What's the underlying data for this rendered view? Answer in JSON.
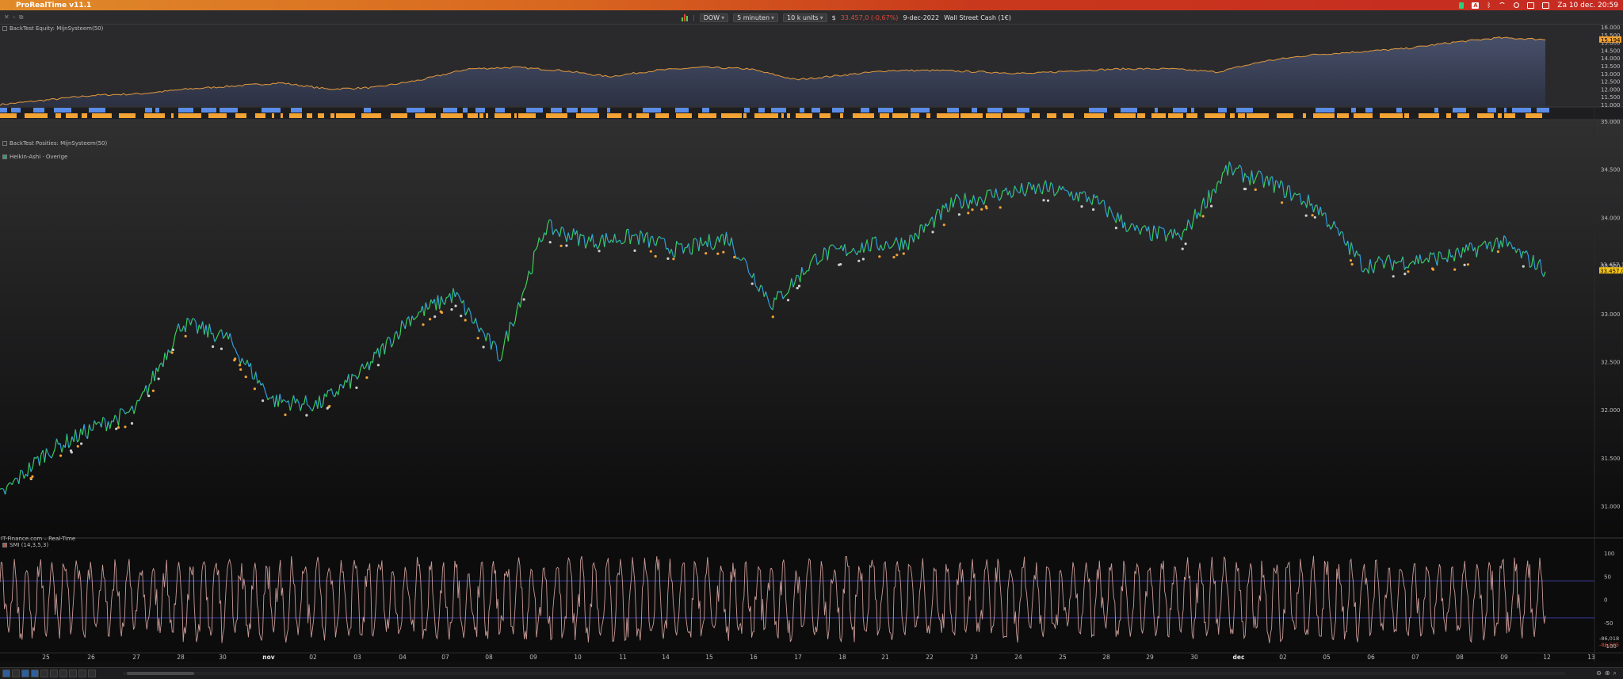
{
  "menubar": {
    "app_name": "ProRealTime v11.1",
    "clock": "Za 10 dec. 20:59",
    "icons": [
      "apple-icon",
      "green-status-icon",
      "a-input-icon",
      "bluetooth-icon",
      "wifi-icon",
      "search-icon",
      "display-icon",
      "control-center-icon"
    ]
  },
  "toolbar": {
    "instrument": "DOW",
    "timeframe": "5 minuten",
    "units": "10 k units",
    "currency": "$",
    "price_change": "33.457,0 (-0,67%)",
    "date": "9-dec-2022",
    "market": "Wall Street Cash (1€)"
  },
  "panels": {
    "equity": {
      "label": "BackTest Equity: MijnSysteem(50)",
      "y_ticks": [
        "16.000",
        "15.500",
        "15.000",
        "14.500",
        "14.000",
        "13.500",
        "13.000",
        "12.500",
        "12.000",
        "11.500",
        "11.000"
      ],
      "current": "15.194"
    },
    "positions": {
      "label": "BackTest Posities: MijnSysteem(50)"
    },
    "price": {
      "label": "Heikin-Ashi · Overige",
      "y_ticks": [
        "35.000",
        "34.500",
        "34.000",
        "33.500",
        "33.000",
        "32.500",
        "32.000",
        "31.500",
        "31.000"
      ],
      "current": "33.457,0",
      "current2": "33.457,1",
      "footer": "IT-Finance.com – Real-Time"
    },
    "smi": {
      "label": "SMI (14,3,5,3)",
      "y_ticks": [
        "100",
        "50",
        "0",
        "-50",
        "-100"
      ],
      "current1": "-86,018",
      "current2": "-86,505"
    }
  },
  "x_axis": {
    "labels": [
      "25",
      "26",
      "27",
      "28",
      "30",
      "nov",
      "02",
      "03",
      "04",
      "07",
      "08",
      "09",
      "10",
      "11",
      "14",
      "15",
      "16",
      "17",
      "18",
      "21",
      "22",
      "23",
      "24",
      "25",
      "28",
      "29",
      "30",
      "dec",
      "02",
      "05",
      "06",
      "07",
      "08",
      "09",
      "12",
      "13"
    ]
  },
  "colors": {
    "equity_line": "#e49a3c",
    "equity_fill": "#3a4358",
    "long_block": "#5b8de8",
    "short_block": "#f3a234",
    "candle_up": "#39d353",
    "candle_down": "#2f9be0",
    "smi_line": "#c89a95",
    "smi_level": "#3a3a9a"
  },
  "chart_data": [
    {
      "type": "area",
      "title": "BackTest Equity: MijnSysteem(50)",
      "series": [
        {
          "values": [
            11.0,
            11.3,
            11.6,
            11.7,
            12.0,
            12.2,
            12.4,
            12.0,
            12.1,
            12.6,
            13.3,
            13.4,
            13.2,
            12.8,
            13.2,
            13.4,
            13.3,
            12.6,
            12.9,
            13.2,
            13.2,
            13.1,
            13.0,
            13.2,
            13.3,
            13.3,
            13.1,
            13.8,
            14.2,
            14.4,
            14.6,
            15.0,
            15.3,
            15.194
          ]
        }
      ],
      "ylim": [
        10.9,
        16.0
      ]
    },
    {
      "type": "line",
      "title": "Heikin-Ashi",
      "x": [
        "25",
        "26",
        "27",
        "28",
        "30",
        "nov",
        "02",
        "03",
        "04",
        "07",
        "08",
        "09",
        "10",
        "11",
        "14",
        "15",
        "16",
        "17",
        "18",
        "21",
        "22",
        "23",
        "24",
        "25",
        "28",
        "29",
        "30",
        "dec",
        "02",
        "05",
        "06",
        "07",
        "08",
        "09",
        "12"
      ],
      "series": [
        {
          "values": [
            31.1,
            31.55,
            31.8,
            32.0,
            32.9,
            32.75,
            32.1,
            32.05,
            32.4,
            32.95,
            33.2,
            32.55,
            33.9,
            33.75,
            33.8,
            33.65,
            33.8,
            33.1,
            33.6,
            33.7,
            33.75,
            34.15,
            34.25,
            34.3,
            34.2,
            33.85,
            33.8,
            34.5,
            34.35,
            34.1,
            33.5,
            33.55,
            33.6,
            33.75,
            33.457
          ]
        }
      ],
      "ylim": [
        30.7,
        35.0
      ]
    },
    {
      "type": "line",
      "title": "SMI (14,3,5,3)",
      "ylim": [
        -100,
        100
      ],
      "levels": [
        40,
        -40
      ],
      "series": [
        {
          "values": [
            -40,
            30,
            60,
            -20,
            -70,
            20,
            75,
            -50,
            10,
            65,
            -60,
            -10,
            80,
            -30,
            40,
            -75,
            55,
            -20,
            70,
            -55,
            25,
            85,
            -45,
            5,
            60,
            -80,
            35,
            -15,
            70,
            -60,
            45,
            -35,
            80,
            -50,
            15,
            -86.505
          ]
        }
      ]
    }
  ]
}
